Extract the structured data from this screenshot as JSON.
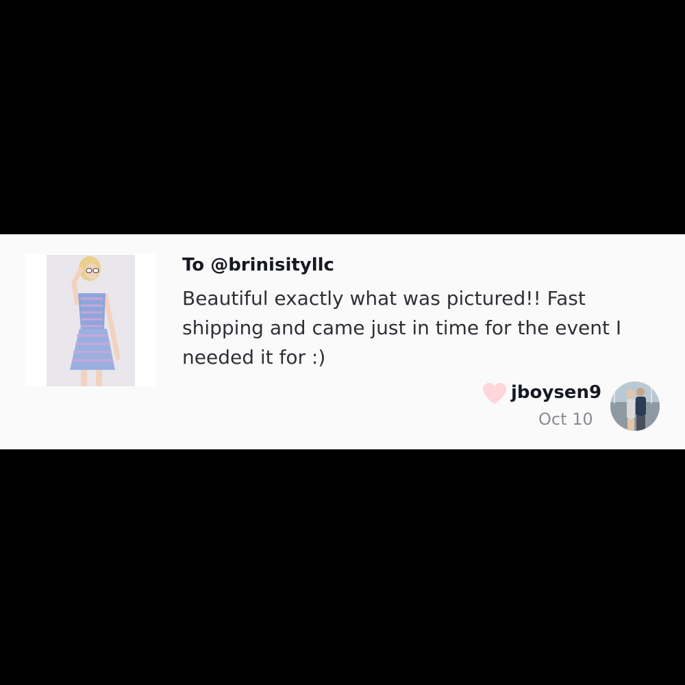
{
  "review": {
    "to": "To @brinisityllc",
    "text": "Beautiful exactly what was pictured!! Fast\nshipping and came just in time for the event I\nneeded it for :)",
    "username": "jboysen9",
    "date": "Oct 10"
  },
  "icons": {
    "like": "heart-icon",
    "avatar": "user-avatar"
  },
  "colors": {
    "heart": "#ffd6dc",
    "card_background": "#fafafa",
    "page_background": "#000000"
  }
}
